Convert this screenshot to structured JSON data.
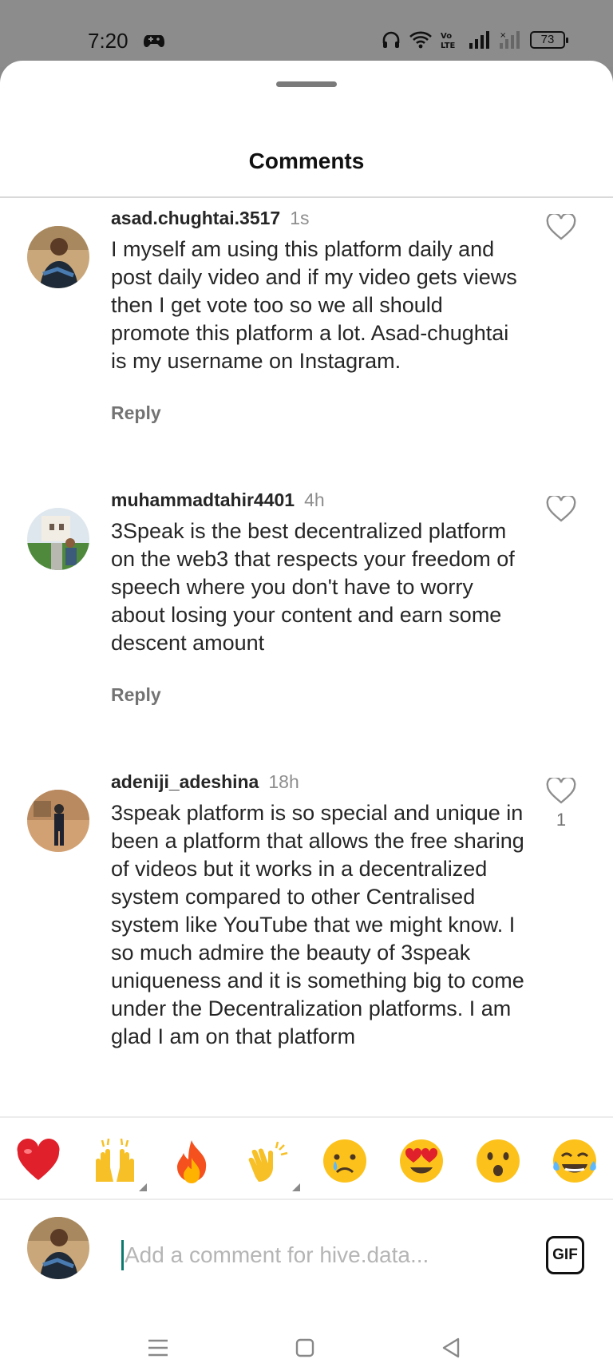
{
  "status_bar": {
    "time": "7:20",
    "battery": "73",
    "icons": [
      "game-controller-icon",
      "headphones-icon",
      "wifi-icon",
      "volte-icon",
      "signal-icon",
      "signal-weak-icon",
      "battery-icon"
    ]
  },
  "sheet": {
    "title": "Comments"
  },
  "comments": [
    {
      "username": "asad.chughtai.3517",
      "time": "1s",
      "text": "I myself am using this platform daily and post daily video and if my video gets views then I get vote too so we all should promote this platform a lot. Asad-chughtai is my username on Instagram.",
      "reply_label": "Reply",
      "likes": ""
    },
    {
      "username": "muhammadtahir4401",
      "time": "4h",
      "text": "3Speak is the best decentralized platform on the web3 that respects your freedom of speech where you don't have to worry about losing your content and earn some descent amount",
      "reply_label": "Reply",
      "likes": ""
    },
    {
      "username": "adeniji_adeshina",
      "time": "18h",
      "text": "3speak platform is so special and unique in been a platform that allows the free sharing of videos but it works in a decentralized system compared to other Centralised system like YouTube that we might know. I so much admire the beauty of 3speak uniqueness and it is something big to come under the Decentralization platforms. I am glad I am on that platform",
      "reply_label": "",
      "likes": "1"
    }
  ],
  "emoji_bar": [
    "heart-emoji",
    "raised-hands-emoji",
    "fire-emoji",
    "clapping-hands-emoji",
    "crying-face-emoji",
    "heart-eyes-emoji",
    "surprised-face-emoji",
    "tears-of-joy-emoji"
  ],
  "composer": {
    "placeholder": "Add a comment for hive.data...",
    "gif_label": "GIF"
  },
  "nav": [
    "menu-icon",
    "home-square-icon",
    "back-triangle-icon"
  ],
  "colors": {
    "status_bar": "#8c8c8c",
    "heart_emoji": "#e0202a",
    "caret": "#0a7a6e"
  }
}
